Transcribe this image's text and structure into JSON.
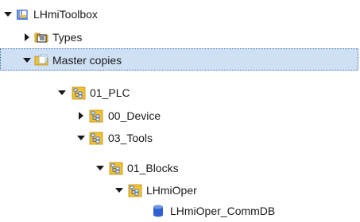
{
  "tree": {
    "items": [
      {
        "label": "LHmiToolbox",
        "icon": "library-icon",
        "expanded": true
      },
      {
        "label": "Types",
        "icon": "types-folder-icon",
        "expanded": false
      },
      {
        "label": "Master copies",
        "icon": "master-copies-folder-icon",
        "expanded": true,
        "selected": true
      },
      {
        "label": "01_PLC",
        "icon": "plc-folder-icon",
        "expanded": true
      },
      {
        "label": "00_Device",
        "icon": "plc-folder-icon",
        "expanded": false
      },
      {
        "label": "03_Tools",
        "icon": "plc-folder-icon",
        "expanded": true
      },
      {
        "label": "01_Blocks",
        "icon": "plc-folder-icon",
        "expanded": true
      },
      {
        "label": "LHmiOper",
        "icon": "plc-folder-icon",
        "expanded": true
      },
      {
        "label": "LHmiOper_CommDB",
        "icon": "database-icon"
      }
    ]
  },
  "colors": {
    "selection_bg": "#cfe0f4",
    "selection_border": "#3a6ea5",
    "folder_yellow": "#f2c230",
    "db_blue": "#2f5fd0"
  }
}
